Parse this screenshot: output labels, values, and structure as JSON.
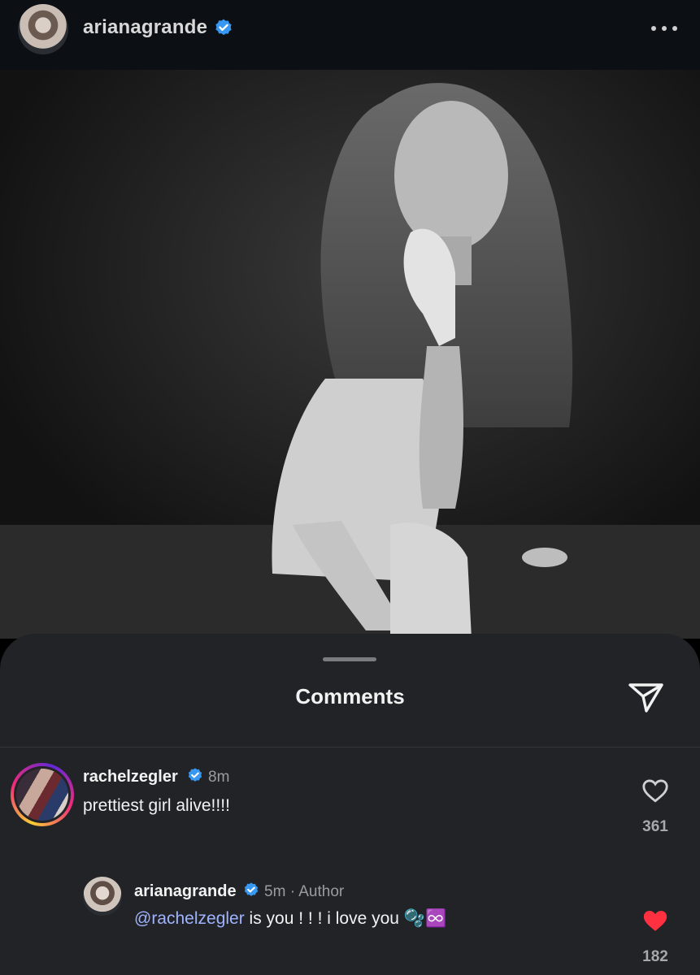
{
  "header": {
    "username": "arianagrande",
    "verified": true,
    "more_icon": "more-horizontal-icon"
  },
  "post": {
    "image_alt": "Black and white photo of a woman crouching in lace gloves",
    "colors": {
      "background": "#101010"
    }
  },
  "comments_sheet": {
    "title": "Comments",
    "share_icon": "send-icon",
    "comments": [
      {
        "username": "rachelzegler",
        "verified": true,
        "time": "8m",
        "text": "prettiest girl alive!!!!",
        "likes": "361",
        "liked": false
      }
    ],
    "replies": [
      {
        "username": "arianagrande",
        "verified": true,
        "time": "5m",
        "author_label": "Author",
        "meta_separator": "·",
        "mention": "@rachelzegler",
        "text": " is you ! ! ! i love you ",
        "emoji": "🫧♾️",
        "likes": "182",
        "liked": true
      }
    ]
  },
  "colors": {
    "verified_blue": "#3897f0",
    "like_red": "#ff3040",
    "mention_blue": "#9fb3ff",
    "sheet_background": "#212327"
  }
}
